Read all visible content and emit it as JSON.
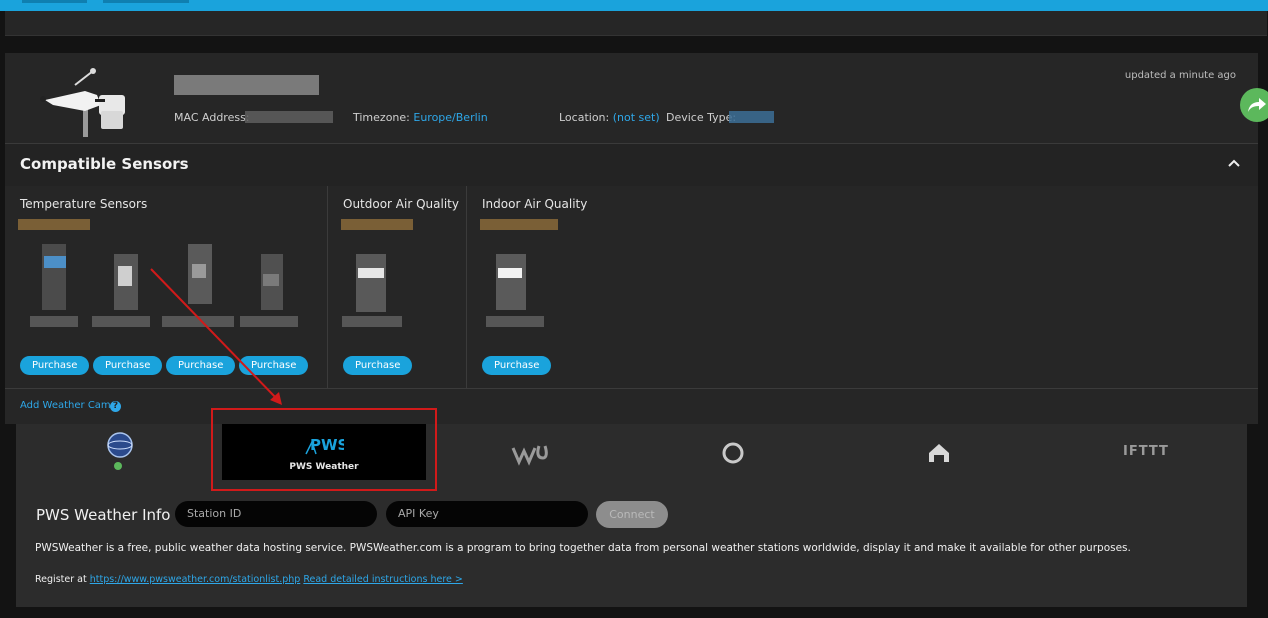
{
  "device": {
    "updated": "updated a minute ago",
    "mac_label": "MAC Address:",
    "timezone_label": "Timezone:",
    "timezone_value": "Europe/Berlin",
    "location_label": "Location:",
    "location_value": "(not set)",
    "device_type_label": "Device Type:"
  },
  "sensors": {
    "title": "Compatible Sensors",
    "groups": [
      {
        "label": "Temperature Sensors"
      },
      {
        "label": "Outdoor Air Quality"
      },
      {
        "label": "Indoor Air Quality"
      }
    ],
    "purchase_label": "Purchase",
    "add_weather_cam": "Add Weather Cam",
    "help_glyph": "?"
  },
  "services": {
    "active_label": "PWS Weather",
    "pws_logo_text": "PWS",
    "ifttt": "IFTTT",
    "icons": [
      "globe-icon",
      "pws-weather-icon",
      "wunderground-icon",
      "ring-icon",
      "home-icon",
      "ifttt-icon"
    ]
  },
  "pws_info": {
    "label": "PWS Weather Info :",
    "station_id_placeholder": "Station ID",
    "api_key_placeholder": "API Key",
    "connect_label": "Connect",
    "description": "PWSWeather is a free, public weather data hosting service. PWSWeather.com is a program to bring together data from personal weather stations worldwide, display it and make it available for other purposes.",
    "register_prefix": "Register at",
    "register_link": "https://www.pwsweather.com/stationlist.php",
    "instructions_link": "Read detailed instructions here >"
  },
  "colors": {
    "accent": "#1aa3dc",
    "highlight": "#d11a1a",
    "share": "#5cb85c"
  }
}
